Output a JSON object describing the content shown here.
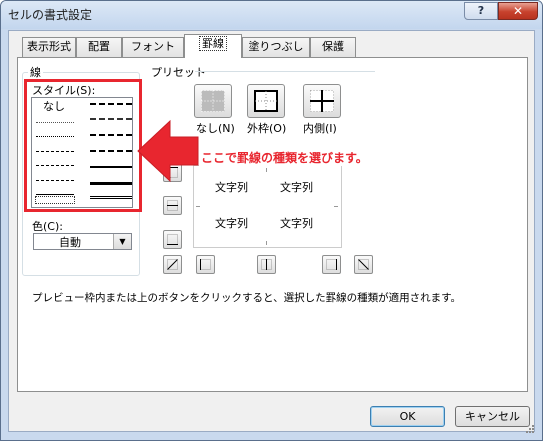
{
  "window": {
    "title": "セルの書式設定",
    "help_label": "?",
    "close_label": "✕"
  },
  "tabs": [
    {
      "label": "表示形式"
    },
    {
      "label": "配置"
    },
    {
      "label": "フォント"
    },
    {
      "label": "罫線",
      "active": true
    },
    {
      "label": "塗りつぶし"
    },
    {
      "label": "保護"
    }
  ],
  "line": {
    "group_label": "線",
    "style_label": "スタイル(S):",
    "none_label": "なし",
    "color_label": "色(C):",
    "color_value": "自動",
    "selected_style": "none"
  },
  "preset": {
    "group_label": "プリセット",
    "buttons": [
      {
        "label": "なし(N)",
        "icon": "border-none-icon"
      },
      {
        "label": "外枠(O)",
        "icon": "border-outline-icon"
      },
      {
        "label": "内側(I)",
        "icon": "border-inside-icon"
      }
    ]
  },
  "preview": {
    "cells": [
      "文字列",
      "文字列",
      "文字列",
      "文字列"
    ]
  },
  "annotation": {
    "text": "ここで罫線の種類を選びます。",
    "color": "#e8262f"
  },
  "description": "プレビュー枠内または上のボタンをクリックすると、選択した罫線の種類が適用されます。",
  "footer": {
    "ok_label": "OK",
    "cancel_label": "キャンセル"
  }
}
